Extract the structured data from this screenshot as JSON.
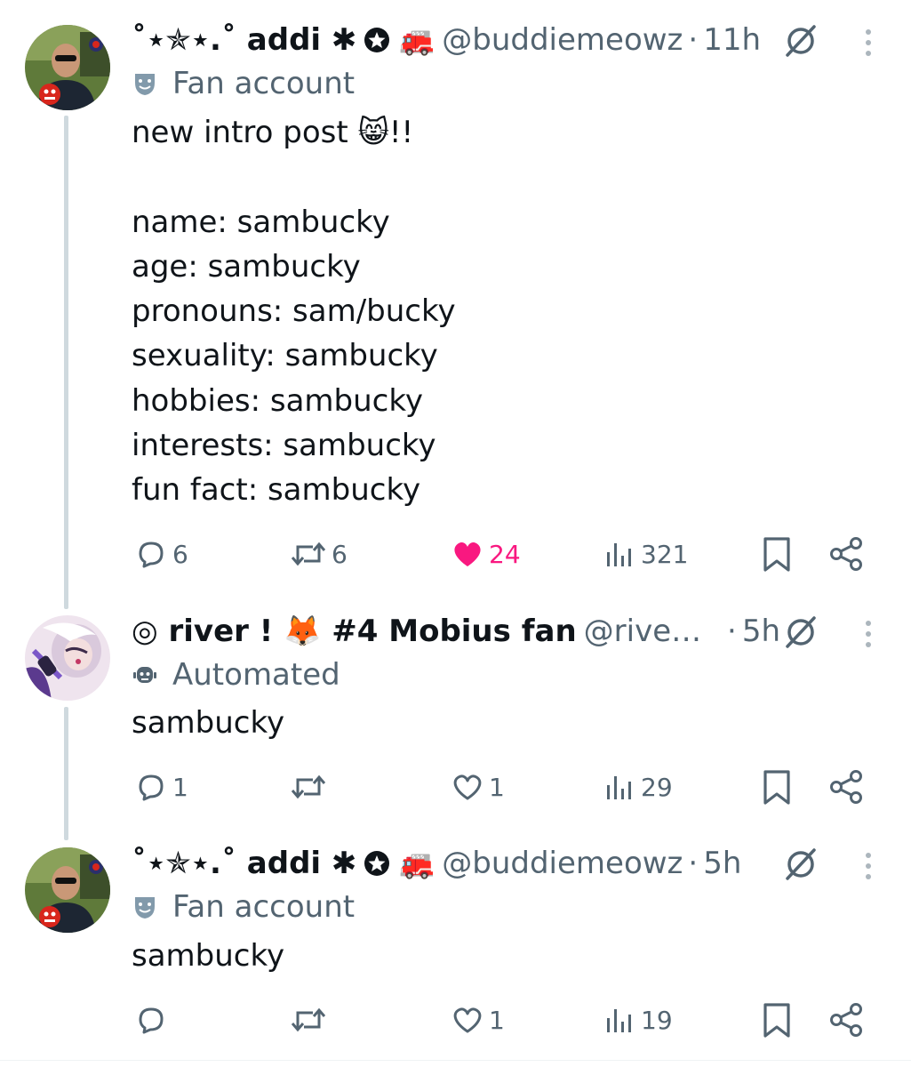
{
  "posts": [
    {
      "display_name": "˚⋆✯⋆.˚ addi ✱",
      "badge_emoji": "🚒",
      "handle": "@buddiemeowz",
      "time": "11h",
      "label": "Fan account",
      "text": "new intro post 😸!!\n\nname: sambucky\nage: sambucky\npronouns: sam/bucky\nsexuality: sambucky\nhobbies: sambucky\ninterests: sambucky\nfun fact: sambucky",
      "replies": "6",
      "reposts": "6",
      "likes": "24",
      "views": "321"
    },
    {
      "display_name": "◎ river ! 🦊 #4 Mobius fan",
      "handle": "@riverr...",
      "time": "5h",
      "label": "Automated",
      "text": "sambucky",
      "replies": "1",
      "reposts": "",
      "likes": "1",
      "views": "29"
    },
    {
      "display_name": "˚⋆✯⋆.˚ addi ✱",
      "badge_emoji": "🚒",
      "handle": "@buddiemeowz",
      "time": "5h",
      "label": "Fan account",
      "text": "sambucky",
      "replies": "",
      "reposts": "",
      "likes": "1",
      "views": "19"
    }
  ],
  "separator": "·",
  "colors": {
    "like": "#f91880",
    "muted": "#536471",
    "thread_line": "#cfd9de"
  },
  "icons": [
    "reply-icon",
    "repost-icon",
    "like-icon",
    "views-icon",
    "bookmark-icon",
    "share-icon",
    "grok-icon",
    "more-icon",
    "theater-masks-icon",
    "robot-icon",
    "star-badge-icon"
  ]
}
